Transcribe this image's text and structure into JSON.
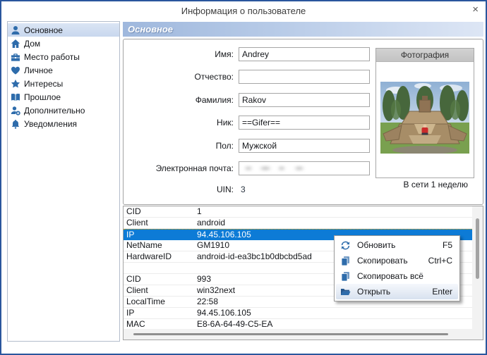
{
  "window": {
    "title": "Информация о пользователе",
    "close_label": "×"
  },
  "sidebar": {
    "items": [
      {
        "label": "Основное",
        "icon": "person-icon",
        "selected": true
      },
      {
        "label": "Дом",
        "icon": "home-icon",
        "selected": false
      },
      {
        "label": "Место работы",
        "icon": "briefcase-icon",
        "selected": false
      },
      {
        "label": "Личное",
        "icon": "heart-icon",
        "selected": false
      },
      {
        "label": "Интересы",
        "icon": "star-icon",
        "selected": false
      },
      {
        "label": "Прошлое",
        "icon": "book-icon",
        "selected": false
      },
      {
        "label": "Дополнительно",
        "icon": "person-plus-icon",
        "selected": false
      },
      {
        "label": "Уведомления",
        "icon": "bell-icon",
        "selected": false
      }
    ]
  },
  "main": {
    "section_title": "Основное",
    "fields": [
      {
        "label": "Имя:",
        "value": "Andrey"
      },
      {
        "label": "Отчество:",
        "value": ""
      },
      {
        "label": "Фамилия:",
        "value": "Rakov"
      },
      {
        "label": "Ник:",
        "value": "==Gifer=="
      },
      {
        "label": "Пол:",
        "value": "Мужской"
      },
      {
        "label": "Электронная почта:",
        "value": "",
        "note": "value blurred in source"
      }
    ],
    "uin": {
      "label": "UIN:",
      "value": "3"
    },
    "photo": {
      "title": "Фотография",
      "status": "В сети 1 неделю"
    }
  },
  "table": {
    "rows": [
      {
        "key": "CID",
        "value": "1",
        "selected": false
      },
      {
        "key": "Client",
        "value": "android",
        "selected": false
      },
      {
        "key": "IP",
        "value": "94.45.106.105",
        "selected": true
      },
      {
        "key": "NetName",
        "value": "GM1910",
        "selected": false
      },
      {
        "key": "HardwareID",
        "value": "android-id-ea3bc1b0dbcbd5ad",
        "selected": false
      },
      {
        "key": "",
        "value": "",
        "selected": false
      },
      {
        "key": "CID",
        "value": "993",
        "selected": false
      },
      {
        "key": "Client",
        "value": "win32next",
        "selected": false
      },
      {
        "key": "LocalTime",
        "value": "22:58",
        "selected": false
      },
      {
        "key": "IP",
        "value": "94.45.106.105",
        "selected": false
      },
      {
        "key": "MAC",
        "value": "E8-6A-64-49-C5-EA",
        "selected": false
      }
    ]
  },
  "context_menu": {
    "items": [
      {
        "label": "Обновить",
        "shortcut": "F5",
        "icon": "refresh-icon",
        "highlighted": false
      },
      {
        "label": "Скопировать",
        "shortcut": "Ctrl+C",
        "icon": "copy-icon",
        "highlighted": false
      },
      {
        "label": "Скопировать всё",
        "shortcut": "",
        "icon": "copy-all-icon",
        "highlighted": false
      },
      {
        "label": "Открыть",
        "shortcut": "Enter",
        "icon": "open-folder-icon",
        "highlighted": true
      }
    ]
  },
  "colors": {
    "window_border": "#2a569d",
    "accent_icon_blue": "#2e6cab",
    "selection_blue": "#0d7bd6",
    "header_gradient_start": "#9fb8dd",
    "header_gradient_end": "#dde6f5",
    "sidebar_selected_bg": "#cfdcf0",
    "photo_header_bg": "#c9c9c9"
  }
}
